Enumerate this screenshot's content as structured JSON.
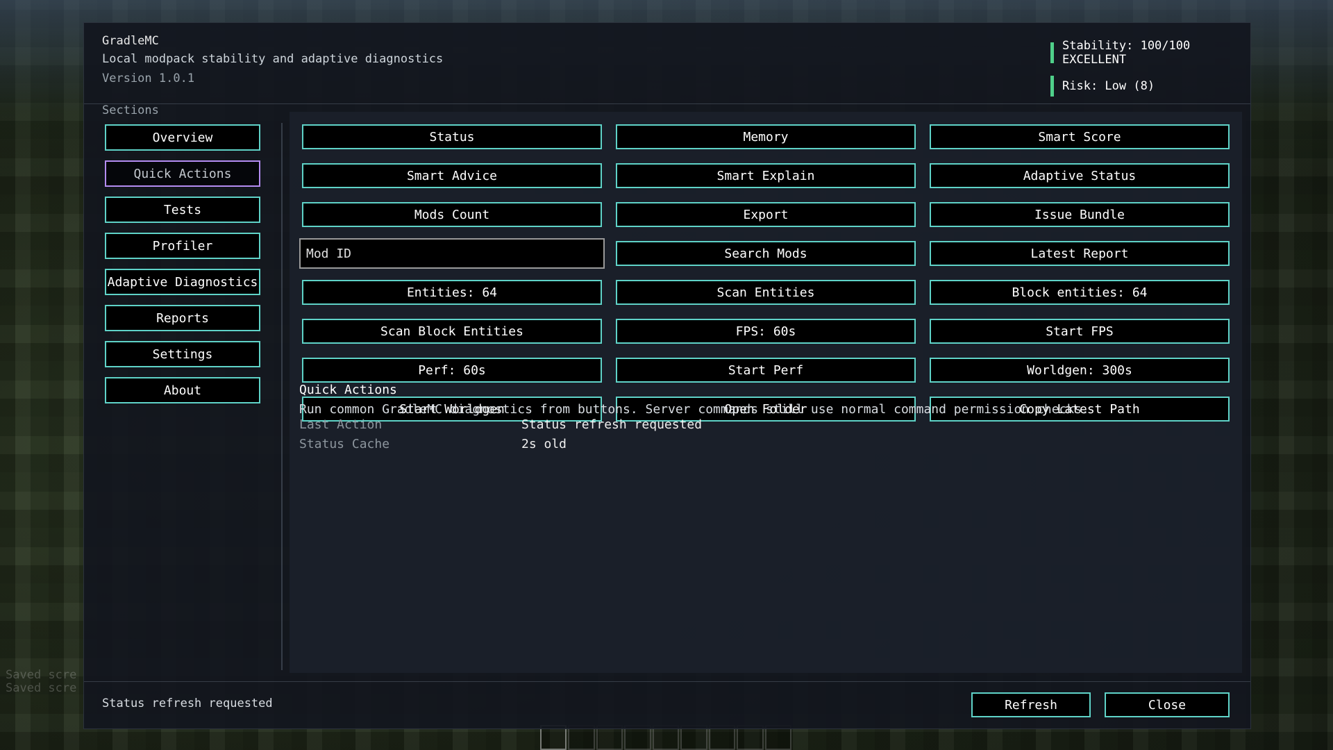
{
  "header": {
    "title": "GradleMC",
    "subtitle": "Local modpack stability and adaptive diagnostics",
    "version": "Version 1.0.1",
    "stability": "Stability: 100/100 EXCELLENT",
    "risk": "Risk: Low (8)",
    "status_color": "#4fd08a"
  },
  "sidebar": {
    "label": "Sections",
    "items": [
      {
        "label": "Overview",
        "active": false
      },
      {
        "label": "Quick Actions",
        "active": true
      },
      {
        "label": "Tests",
        "active": false
      },
      {
        "label": "Profiler",
        "active": false
      },
      {
        "label": "Adaptive Diagnostics",
        "active": false
      },
      {
        "label": "Reports",
        "active": false
      },
      {
        "label": "Settings",
        "active": false
      },
      {
        "label": "About",
        "active": false
      }
    ]
  },
  "grid": {
    "buttons": [
      "Status",
      "Memory",
      "Smart Score",
      "Smart Advice",
      "Smart Explain",
      "Adaptive Status",
      "Mods Count",
      "Export",
      "Issue Bundle",
      "Search Mods",
      "Latest Report",
      "Entities: 64",
      "Scan Entities",
      "Block entities: 64",
      "Scan Block Entities",
      "FPS: 60s",
      "Start FPS",
      "Perf: 60s",
      "Start Perf",
      "Worldgen: 300s",
      "Start Worldgen",
      "Open Folder",
      "Copy Latest Path"
    ],
    "mod_id_placeholder": "Mod ID"
  },
  "quick_actions": {
    "title": "Quick Actions",
    "description": "Run common GradleMC diagnostics from buttons. Server commands still use normal command permission checks.",
    "last_action_label": "Last Action",
    "last_action_value": "Status refresh requested",
    "status_cache_label": "Status Cache",
    "status_cache_value": "2s old"
  },
  "footer": {
    "status": "Status refresh requested",
    "refresh_label": "Refresh",
    "close_label": "Close"
  },
  "background": {
    "chat_lines": [
      "Saved scre",
      "Saved scre"
    ]
  },
  "colors": {
    "button_border": "#5fd3c8",
    "active_border": "#b48cf2"
  }
}
